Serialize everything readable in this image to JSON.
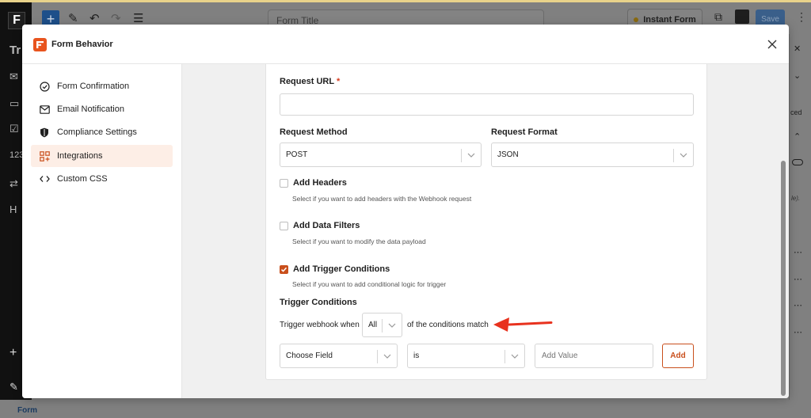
{
  "editor": {
    "logo": "F",
    "title_placeholder": "Form Title",
    "instant_form_label": "Instant Form",
    "save_label": "Save",
    "left_icons": [
      "Tr",
      "✉",
      "▭",
      "☑",
      "123",
      "⇄",
      "H"
    ],
    "right_panel_text": "ced",
    "right_panel_hint": "le).",
    "plus_label": "+",
    "bottom_label": "Form"
  },
  "modal": {
    "title": "Form Behavior",
    "sidebar": [
      {
        "label": "Form Confirmation",
        "icon": "check-circle-icon"
      },
      {
        "label": "Email Notification",
        "icon": "envelope-icon"
      },
      {
        "label": "Compliance Settings",
        "icon": "shield-icon"
      },
      {
        "label": "Integrations",
        "icon": "integrations-icon",
        "active": true
      },
      {
        "label": "Custom CSS",
        "icon": "code-icon"
      }
    ],
    "form": {
      "request_url_label": "Request URL",
      "required_mark": "*",
      "request_url_value": "",
      "request_method_label": "Request Method",
      "request_method_value": "POST",
      "request_format_label": "Request Format",
      "request_format_value": "JSON",
      "add_headers_label": "Add Headers",
      "add_headers_hint": "Select if you want to add headers with the Webhook request",
      "add_headers_checked": false,
      "add_filters_label": "Add Data Filters",
      "add_filters_hint": "Select if you want to modify the data payload",
      "add_filters_checked": false,
      "add_trigger_label": "Add Trigger Conditions",
      "add_trigger_hint": "Select if you want to add conditional logic for trigger",
      "add_trigger_checked": true,
      "trigger_conditions_label": "Trigger Conditions",
      "trigger_when_prefix": "Trigger webhook when",
      "trigger_match_value": "All",
      "trigger_when_suffix": "of the conditions match",
      "choose_field_value": "Choose Field",
      "operator_value": "is",
      "value_placeholder": "Add Value",
      "add_button_label": "Add"
    }
  },
  "colors": {
    "accent": "#c94f1c",
    "logo_orange": "#e8541e",
    "arrow_red": "#e8321e",
    "active_bg": "#fdeee6"
  }
}
